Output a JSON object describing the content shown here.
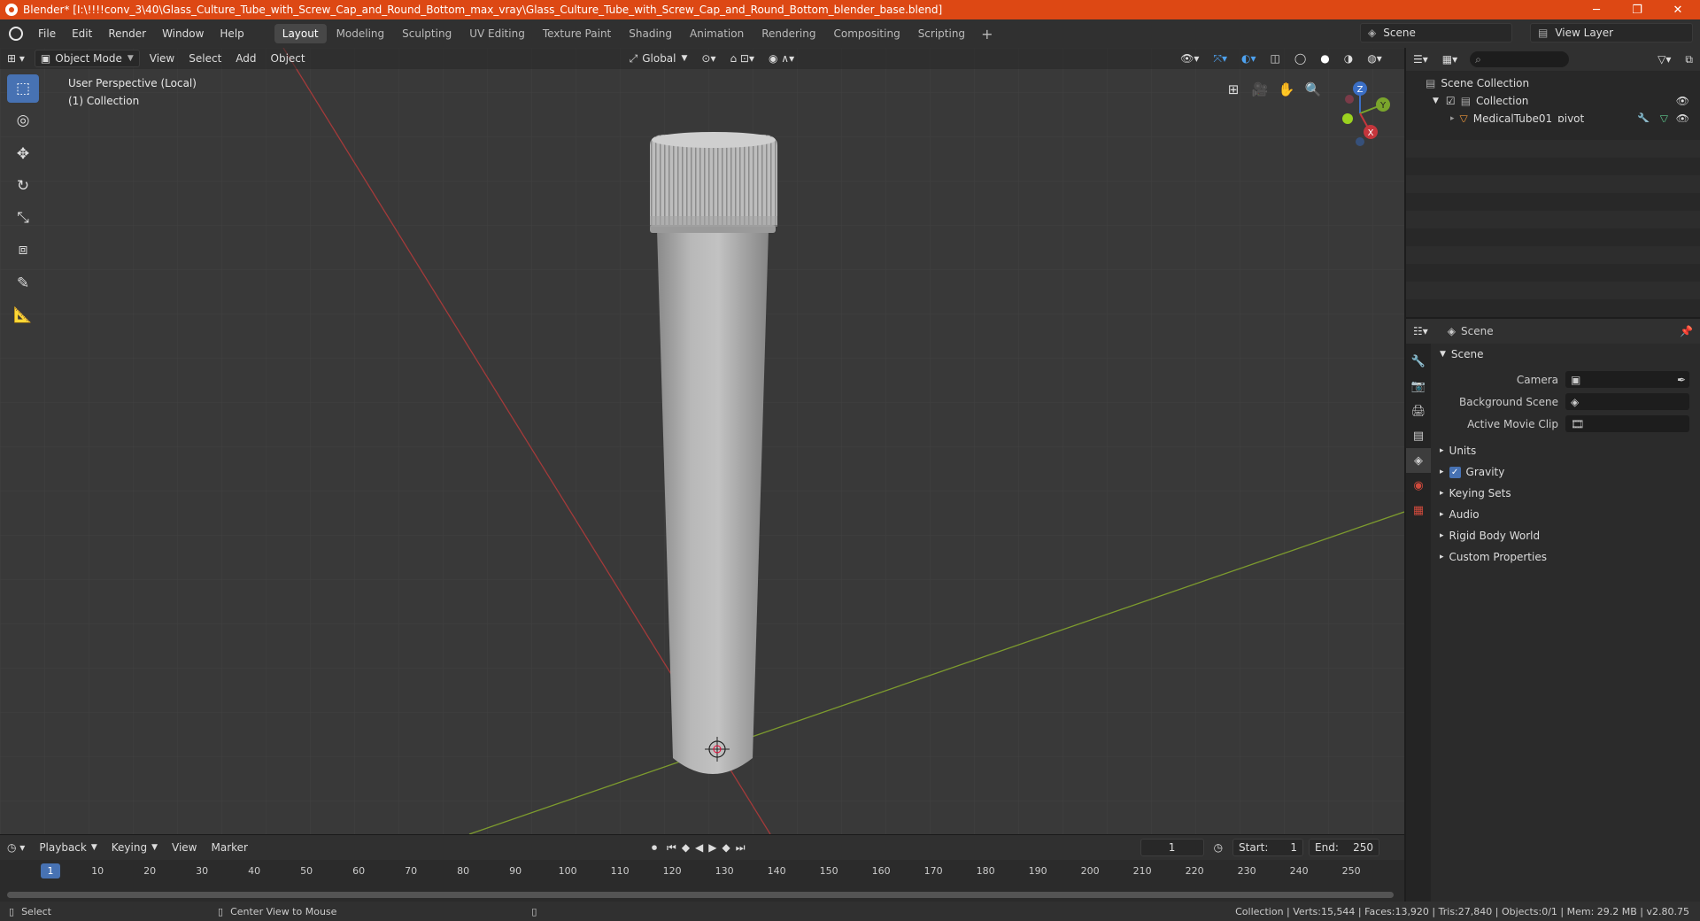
{
  "window": {
    "title": "Blender* [I:\\!!!!conv_3\\40\\Glass_Culture_Tube_with_Screw_Cap_and_Round_Bottom_max_vray\\Glass_Culture_Tube_with_Screw_Cap_and_Round_Bottom_blender_base.blend]",
    "minimize": "─",
    "maximize": "❐",
    "close": "✕"
  },
  "menu": [
    "File",
    "Edit",
    "Render",
    "Window",
    "Help"
  ],
  "workspaces": [
    "Layout",
    "Modeling",
    "Sculpting",
    "UV Editing",
    "Texture Paint",
    "Shading",
    "Animation",
    "Rendering",
    "Compositing",
    "Scripting"
  ],
  "active_workspace": "Layout",
  "scene_selector": "Scene",
  "view_layer": "View Layer",
  "viewport_header": {
    "mode": "Object Mode",
    "menus": [
      "View",
      "Select",
      "Add",
      "Object"
    ],
    "orientation": "Global"
  },
  "viewport": {
    "perspective": "User Perspective (Local)",
    "collection": "(1) Collection",
    "gizmo": {
      "z": "Z",
      "y": "Y",
      "x": "X"
    }
  },
  "toolbar_tools": [
    "select-box-icon",
    "cursor-icon",
    "move-icon",
    "rotate-icon",
    "scale-icon",
    "transform-icon",
    "annotate-icon",
    "measure-icon"
  ],
  "outliner": {
    "scene_collection": "Scene Collection",
    "collection": "Collection",
    "object": "MedicalTube01_pivot"
  },
  "properties": {
    "header": "Scene",
    "section": "Scene",
    "camera_label": "Camera",
    "background_scene_label": "Background Scene",
    "active_movie_clip_label": "Active Movie Clip",
    "panels": [
      "Units",
      "Gravity",
      "Keying Sets",
      "Audio",
      "Rigid Body World",
      "Custom Properties"
    ],
    "gravity_checked": true
  },
  "timeline": {
    "menus": [
      "Playback",
      "Keying",
      "View",
      "Marker"
    ],
    "current_frame": "1",
    "start_label": "Start:",
    "start": "1",
    "end_label": "End:",
    "end": "250",
    "ticks": [
      "10",
      "20",
      "30",
      "40",
      "50",
      "60",
      "70",
      "80",
      "90",
      "100",
      "110",
      "120",
      "130",
      "140",
      "150",
      "160",
      "170",
      "180",
      "190",
      "200",
      "210",
      "220",
      "230",
      "240",
      "250"
    ]
  },
  "status": {
    "left": "Select",
    "middle": "Center View to Mouse",
    "right": "Collection | Verts:15,544 | Faces:13,920 | Tris:27,840 | Objects:0/1 | Mem: 29.2 MB | v2.80.75"
  },
  "colors": {
    "titlebar": "#dd4814",
    "accent": "#4772b3",
    "viewport_bg": "#393939",
    "x_axis": "#a33a3a",
    "y_axis": "#7d9b2e"
  }
}
